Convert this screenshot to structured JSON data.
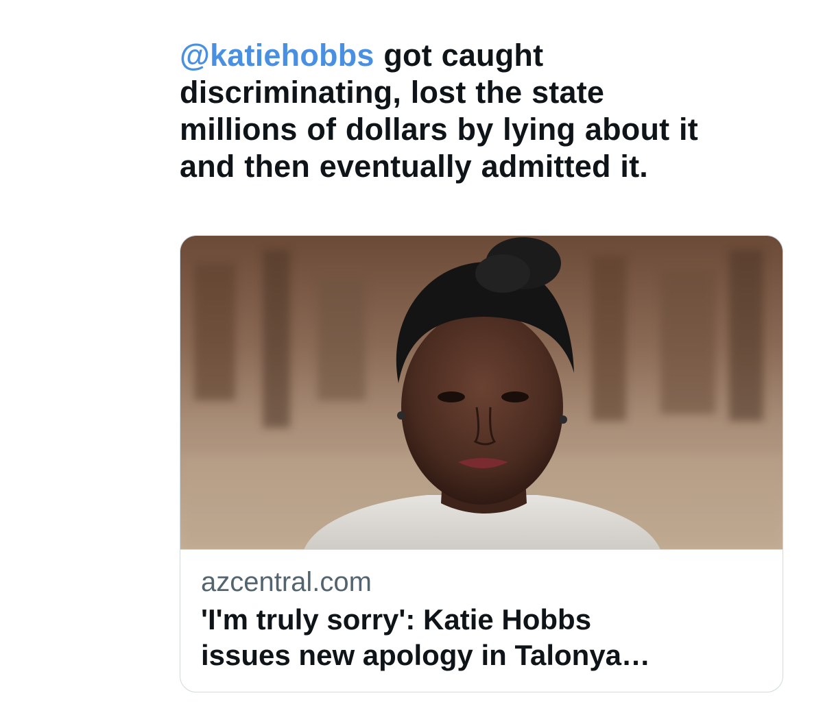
{
  "tweet": {
    "mention": "@katiehobbs",
    "text_line1_rest": " got caught",
    "text_line2": "discriminating, lost the state",
    "text_line3": "millions of dollars by lying about it",
    "text_line4": "and then eventually admitted it."
  },
  "card": {
    "domain": "azcentral.com",
    "title_line1": "'I'm truly sorry': Katie Hobbs",
    "title_line2": "issues new apology in Talonya…",
    "image_icon": "news-photo-portrait"
  },
  "colors": {
    "mention": "#4a90e2",
    "text": "#0f1419",
    "secondary": "#536471",
    "border": "#cfd9de"
  }
}
